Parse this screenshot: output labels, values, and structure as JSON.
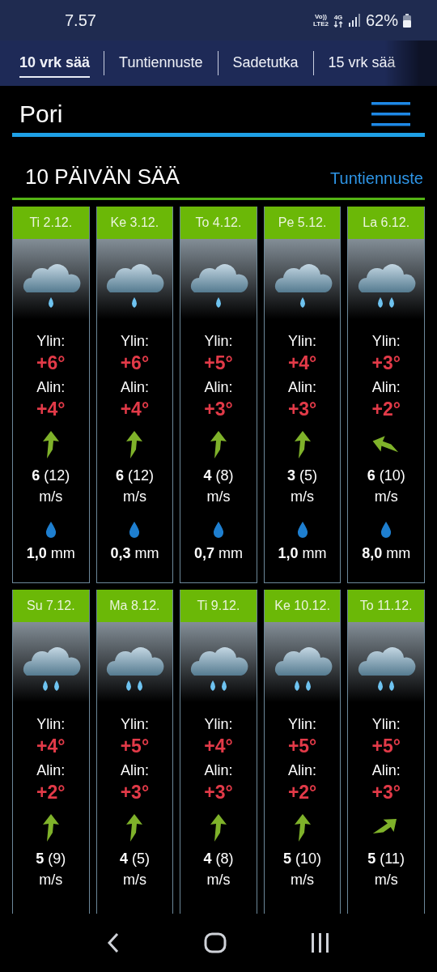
{
  "status_bar": {
    "time": "7.57",
    "volte": "Vo))",
    "lte": "LTE2",
    "data": "4G",
    "battery": "62%"
  },
  "tabs": [
    {
      "label": "10 vrk sää",
      "selected": true
    },
    {
      "label": "Tuntiennuste",
      "selected": false
    },
    {
      "label": "Sadetutka",
      "selected": false
    },
    {
      "label": "15 vrk sää",
      "selected": false
    }
  ],
  "header": {
    "title": "Pori"
  },
  "section": {
    "title": "10 PÄIVÄN SÄÄ",
    "link": "Tuntiennuste"
  },
  "days": [
    {
      "date": "Ti 2.12.",
      "weather_icon": {
        "kind": "light_rain"
      },
      "high_label": "Ylin:",
      "high": "+6°",
      "low_label": "Alin:",
      "low": "+4°",
      "wind_arrow": {
        "kind": "N"
      },
      "wind": "**6** (12)",
      "wind_unit": "m/s",
      "precip": "**1,0** mm"
    },
    {
      "date": "Ke 3.12.",
      "weather_icon": {
        "kind": "light_rain"
      },
      "high_label": "Ylin:",
      "high": "+6°",
      "low_label": "Alin:",
      "low": "+4°",
      "wind_arrow": {
        "kind": "N"
      },
      "wind": "**6** (12)",
      "wind_unit": "m/s",
      "precip": "**0,3** mm"
    },
    {
      "date": "To 4.12.",
      "weather_icon": {
        "kind": "light_rain"
      },
      "high_label": "Ylin:",
      "high": "+5°",
      "low_label": "Alin:",
      "low": "+3°",
      "wind_arrow": {
        "kind": "N"
      },
      "wind": "**4** (8)",
      "wind_unit": "m/s",
      "precip": "**0,7** mm"
    },
    {
      "date": "Pe 5.12.",
      "weather_icon": {
        "kind": "light_rain"
      },
      "high_label": "Ylin:",
      "high": "+4°",
      "low_label": "Alin:",
      "low": "+3°",
      "wind_arrow": {
        "kind": "N"
      },
      "wind": "**3** (5)",
      "wind_unit": "m/s",
      "precip": "**1,0** mm"
    },
    {
      "date": "La 6.12.",
      "weather_icon": {
        "kind": "rain"
      },
      "high_label": "Ylin:",
      "high": "+3°",
      "low_label": "Alin:",
      "low": "+2°",
      "wind_arrow": {
        "kind": "W"
      },
      "wind": "**6** (10)",
      "wind_unit": "m/s",
      "precip": "**8,0** mm"
    },
    {
      "date": "Su 7.12.",
      "weather_icon": {
        "kind": "rain"
      },
      "high_label": "Ylin:",
      "high": "+4°",
      "low_label": "Alin:",
      "low": "+2°",
      "wind_arrow": {
        "kind": "N"
      },
      "wind": "**5** (9)",
      "wind_unit": "m/s"
    },
    {
      "date": "Ma 8.12.",
      "weather_icon": {
        "kind": "rain"
      },
      "high_label": "Ylin:",
      "high": "+5°",
      "low_label": "Alin:",
      "low": "+3°",
      "wind_arrow": {
        "kind": "N"
      },
      "wind": "**4** (5)",
      "wind_unit": "m/s"
    },
    {
      "date": "Ti 9.12.",
      "weather_icon": {
        "kind": "rain"
      },
      "high_label": "Ylin:",
      "high": "+4°",
      "low_label": "Alin:",
      "low": "+3°",
      "wind_arrow": {
        "kind": "N"
      },
      "wind": "**4** (8)",
      "wind_unit": "m/s"
    },
    {
      "date": "Ke 10.12.",
      "weather_icon": {
        "kind": "rain"
      },
      "high_label": "Ylin:",
      "high": "+5°",
      "low_label": "Alin:",
      "low": "+2°",
      "wind_arrow": {
        "kind": "N"
      },
      "wind": "**5** (10)",
      "wind_unit": "m/s"
    },
    {
      "date": "To 11.12.",
      "weather_icon": {
        "kind": "rain"
      },
      "high_label": "Ylin:",
      "high": "+5°",
      "low_label": "Alin:",
      "low": "+3°",
      "wind_arrow": {
        "kind": "NE"
      },
      "wind": "**5** (11)",
      "wind_unit": "m/s"
    }
  ]
}
